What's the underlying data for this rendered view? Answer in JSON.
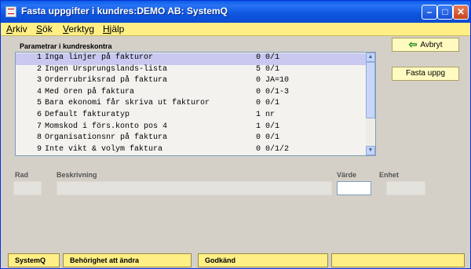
{
  "window": {
    "title": "Fasta uppgifter i kundres:DEMO AB: SystemQ",
    "controls": {
      "minimize": "–",
      "maximize": "□",
      "close": "✕"
    }
  },
  "menu": [
    "Arkiv",
    "Sök",
    "Verktyg",
    "Hjälp"
  ],
  "list": {
    "label": "Parametrar i kundreskontra",
    "selected_index": 0,
    "rows": [
      {
        "num": "1",
        "desc": "Inga linjer på fakturor",
        "val": "0",
        "unit": "0/1"
      },
      {
        "num": "2",
        "desc": "Ingen Ursprungslands-lista",
        "val": "5",
        "unit": "0/1"
      },
      {
        "num": "3",
        "desc": "Orderrubriksrad på faktura",
        "val": "0",
        "unit": "JA=10"
      },
      {
        "num": "4",
        "desc": "Med ören på faktura",
        "val": "0",
        "unit": "0/1-3"
      },
      {
        "num": "5",
        "desc": "Bara ekonomi får skriva ut fakturor",
        "val": "0",
        "unit": "0/1"
      },
      {
        "num": "6",
        "desc": "Default fakturatyp",
        "val": "1",
        "unit": "nr"
      },
      {
        "num": "7",
        "desc": "Momskod i förs.konto pos 4",
        "val": "1",
        "unit": "0/1"
      },
      {
        "num": "8",
        "desc": "Organisationsnr på faktura",
        "val": "0",
        "unit": "0/1"
      },
      {
        "num": "9",
        "desc": "Inte vikt & volym faktura",
        "val": "0",
        "unit": "0/1/2"
      }
    ]
  },
  "buttons": {
    "cancel": "Avbryt",
    "fixed": "Fasta uppg"
  },
  "fields": {
    "rad": "Rad",
    "beskrivning": "Beskrivning",
    "varde": "Värde",
    "enhet": "Enhet"
  },
  "status": [
    "SystemQ",
    "Behörighet att ändra",
    "Godkänd",
    ""
  ],
  "colors": {
    "menu_bg": "#ffef85",
    "selected_row": "#c8c8f0",
    "title_bar": "#0a5ce8"
  }
}
